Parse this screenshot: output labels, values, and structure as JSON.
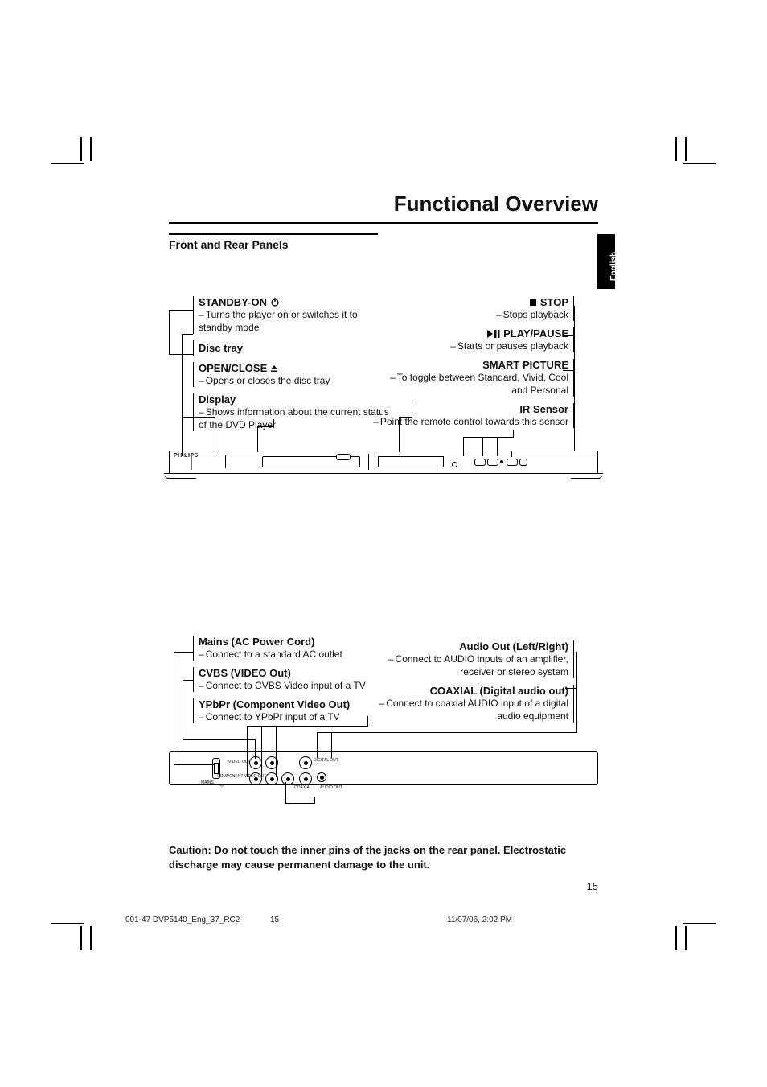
{
  "page": {
    "title": "Functional Overview",
    "section": "Front and Rear Panels",
    "language_tab": "English",
    "page_number": "15"
  },
  "front_left": {
    "standby": {
      "label": "STANDBY-ON",
      "desc": "Turns the player on or switches it to standby mode"
    },
    "disc_tray": {
      "label": "Disc tray"
    },
    "open_close": {
      "label": "OPEN/CLOSE",
      "desc": "Opens or closes the disc tray"
    },
    "display": {
      "label": "Display",
      "desc": "Shows information about the current status of the DVD Player"
    }
  },
  "front_right": {
    "stop": {
      "label": "STOP",
      "desc": "Stops playback"
    },
    "play_pause": {
      "label": "PLAY/PAUSE",
      "desc": "Starts or pauses playback"
    },
    "smart_picture": {
      "label": "SMART PICTURE",
      "desc": "To toggle between Standard, Vivid, Cool and Personal"
    },
    "ir_sensor": {
      "label": "IR Sensor",
      "desc": "Point the remote control towards this sensor"
    }
  },
  "rear_left": {
    "mains": {
      "label": "Mains (AC Power Cord)",
      "desc": "Connect to a standard AC outlet"
    },
    "cvbs": {
      "label": "CVBS (VIDEO Out)",
      "desc": "Connect to CVBS Video input of a TV"
    },
    "ypbpr": {
      "label": "YPbPr (Component Video Out)",
      "desc": "Connect to YPbPr input of a TV"
    }
  },
  "rear_right": {
    "audio_out": {
      "label": "Audio Out (Left/Right)",
      "desc": "Connect to AUDIO inputs of an amplifier, receiver or stereo system"
    },
    "coaxial": {
      "label": "COAXIAL (Digital audio out)",
      "desc": "Connect to coaxial AUDIO input of a digital audio equipment"
    }
  },
  "caution": "Caution: Do not touch the inner pins of the jacks on the rear panel. Electrostatic discharge may cause permanent damage to the unit.",
  "footer": {
    "left": "001-47 DVP5140_Eng_37_RC2",
    "mid": "15",
    "right": "11/07/06, 2:02 PM"
  },
  "jack_labels": {
    "video_out": "VIDEO OUT",
    "digital_out": "DIGITAL OUT",
    "component": "COMPONENT VIDEO OUT",
    "coaxial": "COAXIAL",
    "audio_out": "AUDIO OUT",
    "mains": "MAINS"
  },
  "device_brand": "PHILIPS"
}
